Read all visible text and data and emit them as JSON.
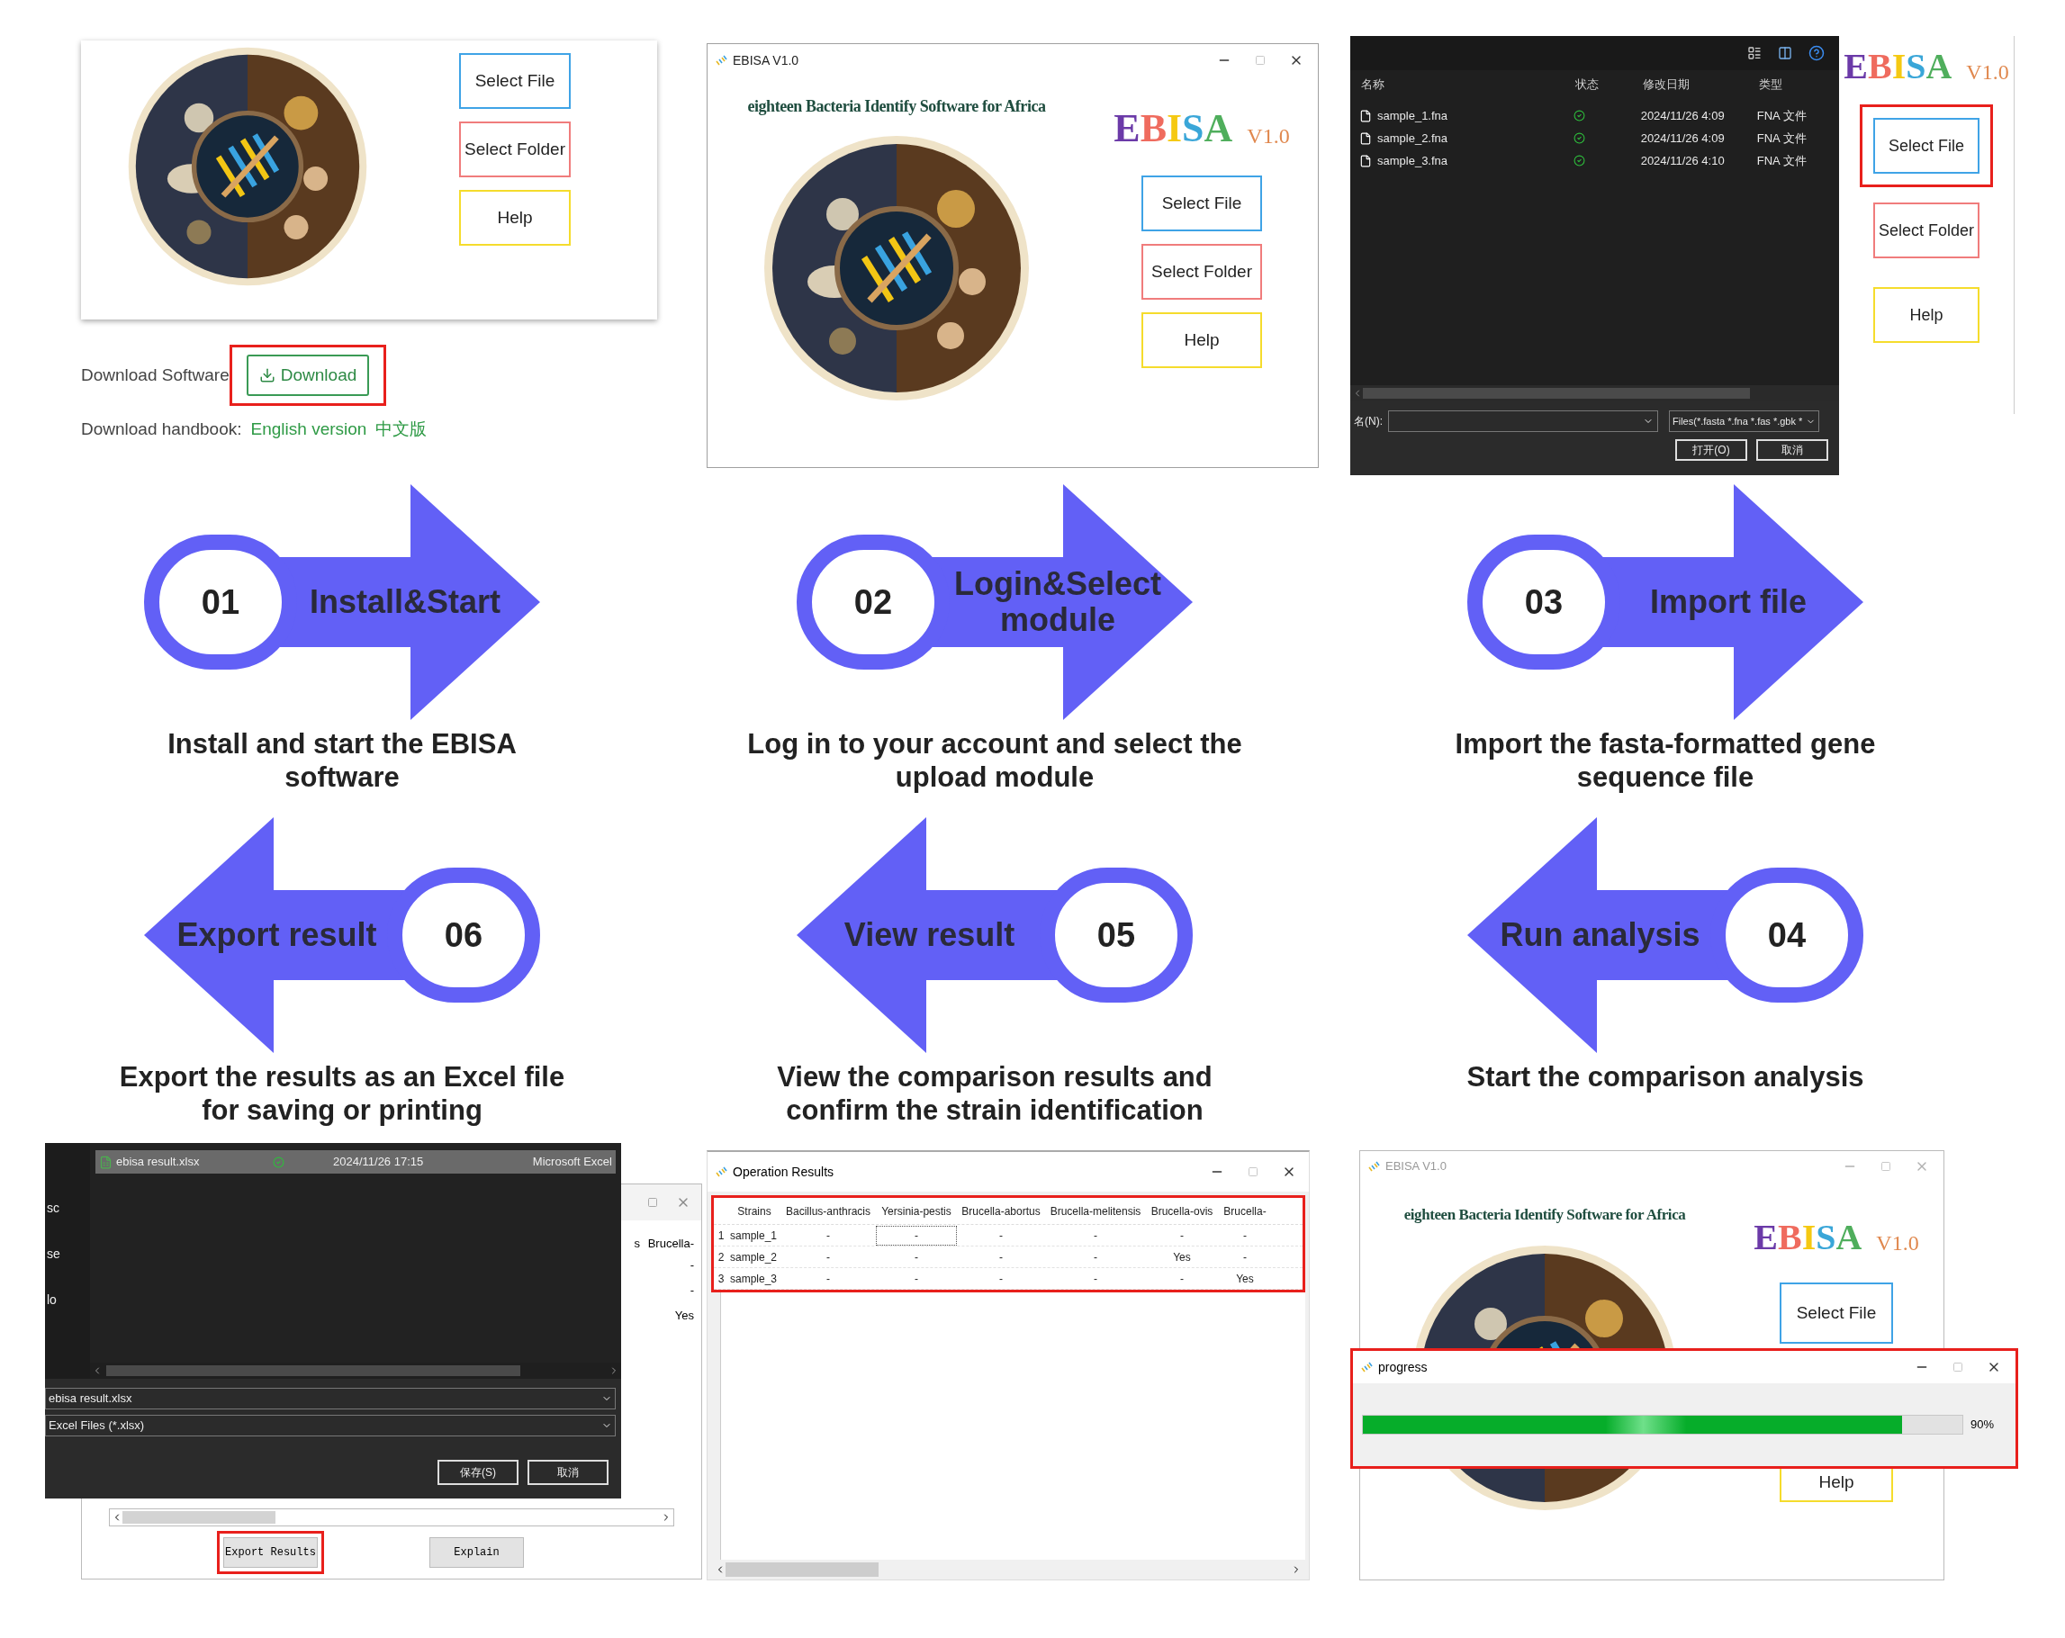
{
  "install_screen": {
    "buttons": [
      {
        "label": "Select File",
        "color": "#3fa3e6"
      },
      {
        "label": "Select Folder",
        "color": "#f07c7c"
      },
      {
        "label": "Help",
        "color": "#f5dc2c"
      }
    ],
    "download_label": "Download Software",
    "download_button": {
      "label": "Download",
      "highlighted": true
    },
    "handbook_label": "Download handbook:",
    "handbook_links": [
      "English version",
      "中文版"
    ]
  },
  "login_screen": {
    "window_title": "EBISA V1.0",
    "subtitle": "eighteen Bacteria Identify Software for Africa",
    "logo": "EBISA",
    "version": "V1.0",
    "buttons": [
      {
        "label": "Select File",
        "color": "#3fa3e6"
      },
      {
        "label": "Select Folder",
        "color": "#f07c7c"
      },
      {
        "label": "Help",
        "color": "#f5dc2c"
      }
    ]
  },
  "import_screen": {
    "dialog": {
      "columns": [
        "名称",
        "状态",
        "修改日期",
        "类型"
      ],
      "files": [
        {
          "name": "sample_1.fna",
          "date": "2024/11/26 4:09",
          "type": "FNA 文件"
        },
        {
          "name": "sample_2.fna",
          "date": "2024/11/26 4:09",
          "type": "FNA 文件"
        },
        {
          "name": "sample_3.fna",
          "date": "2024/11/26 4:10",
          "type": "FNA 文件"
        }
      ],
      "filename_label": "名(N):",
      "filter": "Files(*.fasta *.fna *.fas *.gbk *",
      "buttons": [
        "打开(O)",
        "取消"
      ]
    },
    "logo": "EBISA",
    "version": "V1.0",
    "buttons": [
      {
        "label": "Select File",
        "color": "#3fa3e6",
        "highlighted": true
      },
      {
        "label": "Select Folder",
        "color": "#f07c7c",
        "highlighted": false
      },
      {
        "label": "Help",
        "color": "#f5dc2c",
        "highlighted": false
      }
    ]
  },
  "steps": [
    {
      "number": "01",
      "label": "Install&Start",
      "kind": "right",
      "description_lines": [
        "Install and start the EBISA",
        "software"
      ]
    },
    {
      "number": "02",
      "label": "Login&Select module",
      "kind": "right",
      "description_lines": [
        "Log in to your account and select the",
        "upload module"
      ]
    },
    {
      "number": "03",
      "label": "Import file",
      "kind": "right",
      "description_lines": [
        "Import the fasta-formatted gene",
        "sequence file"
      ]
    },
    {
      "number": "06",
      "label": "Export result",
      "kind": "left",
      "description_lines": [
        "Export the results as an Excel file",
        "for saving or printing"
      ]
    },
    {
      "number": "05",
      "label": "View result",
      "kind": "left",
      "description_lines": [
        "View the comparison results and",
        "confirm the strain identification"
      ]
    },
    {
      "number": "04",
      "label": "Run analysis",
      "kind": "left",
      "description_lines": [
        "Start the comparison analysis"
      ]
    }
  ],
  "export_screen": {
    "dialog": {
      "sidebar_fragments": [
        "sc",
        "se",
        "lo"
      ],
      "file": {
        "name": "ebisa result.xlsx",
        "date": "2024/11/26 17:15",
        "type": "Microsoft Excel"
      },
      "filename": "ebisa result.xlsx",
      "file_type": "Excel Files (*.xlsx)",
      "buttons": [
        "保存(S)",
        "取消"
      ]
    },
    "results_columns": [
      "s",
      "Brucella-"
    ],
    "results_values": [
      "-",
      "-",
      "Yes"
    ],
    "buttons": [
      {
        "label": "Export Results",
        "highlighted": true
      },
      {
        "label": "Explain",
        "highlighted": false
      }
    ]
  },
  "results_screen": {
    "window_title": "Operation Results",
    "table": {
      "highlighted": true,
      "columns": [
        "Strains",
        "Bacillus-anthracis",
        "Yersinia-pestis",
        "Brucella-abortus",
        "Brucella-melitensis",
        "Brucella-ovis",
        "Brucella-"
      ],
      "rows": [
        {
          "index": "1",
          "cells": [
            {
              "text": "sample_1",
              "focused": false
            },
            {
              "text": "-",
              "focused": false
            },
            {
              "text": "-",
              "focused": true
            },
            {
              "text": "-",
              "focused": false
            },
            {
              "text": "-",
              "focused": false
            },
            {
              "text": "-",
              "focused": false
            },
            {
              "text": "-",
              "focused": false
            }
          ]
        },
        {
          "index": "2",
          "cells": [
            {
              "text": "sample_2",
              "focused": false
            },
            {
              "text": "-",
              "focused": false
            },
            {
              "text": "-",
              "focused": false
            },
            {
              "text": "-",
              "focused": false
            },
            {
              "text": "-",
              "focused": false
            },
            {
              "text": "Yes",
              "focused": false
            },
            {
              "text": "-",
              "focused": false
            }
          ]
        },
        {
          "index": "3",
          "cells": [
            {
              "text": "sample_3",
              "focused": false
            },
            {
              "text": "-",
              "focused": false
            },
            {
              "text": "-",
              "focused": false
            },
            {
              "text": "-",
              "focused": false
            },
            {
              "text": "-",
              "focused": false
            },
            {
              "text": "-",
              "focused": false
            },
            {
              "text": "Yes",
              "focused": false
            }
          ]
        }
      ]
    }
  },
  "analysis_screen": {
    "window_title": "EBISA V1.0",
    "subtitle": "eighteen Bacteria Identify Software for Africa",
    "logo": "EBISA",
    "version": "V1.0",
    "buttons": [
      {
        "label": "Select File",
        "color": "#3fa3e6"
      },
      {
        "label": "Help",
        "color": "#f5dc2c"
      }
    ],
    "progress": {
      "title": "progress",
      "level": 0.9,
      "reading": "90%",
      "highlighted": true
    }
  }
}
